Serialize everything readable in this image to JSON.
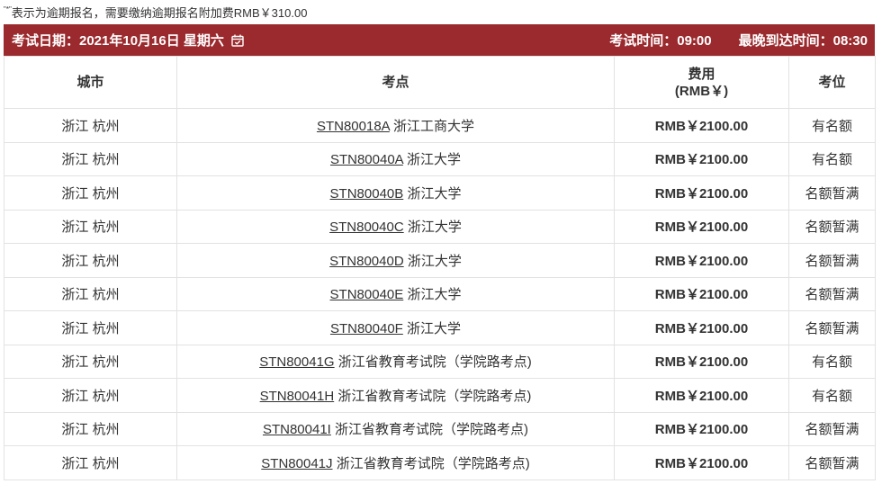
{
  "note": {
    "mark": "\"*\"",
    "text": "表示为逾期报名，需要缴纳逾期报名附加费RMB￥310.00"
  },
  "header": {
    "exam_date": "考试日期：2021年10月16日 星期六",
    "exam_time": "考试时间：09:00",
    "latest_arrival": "最晚到达时间：08:30",
    "calendar_icon": "calendar-check-icon"
  },
  "table": {
    "columns": [
      "城市",
      "考点",
      "费用",
      "(RMB￥)",
      "考位"
    ],
    "rows": [
      {
        "city": "浙江 杭州",
        "code": "STN80018A",
        "center": "浙江工商大学",
        "fee": "RMB￥2100.00",
        "seat": "有名额"
      },
      {
        "city": "浙江 杭州",
        "code": "STN80040A",
        "center": "浙江大学",
        "fee": "RMB￥2100.00",
        "seat": "有名额"
      },
      {
        "city": "浙江 杭州",
        "code": "STN80040B",
        "center": "浙江大学",
        "fee": "RMB￥2100.00",
        "seat": "名额暂满"
      },
      {
        "city": "浙江 杭州",
        "code": "STN80040C",
        "center": "浙江大学",
        "fee": "RMB￥2100.00",
        "seat": "名额暂满"
      },
      {
        "city": "浙江 杭州",
        "code": "STN80040D",
        "center": "浙江大学",
        "fee": "RMB￥2100.00",
        "seat": "名额暂满"
      },
      {
        "city": "浙江 杭州",
        "code": "STN80040E",
        "center": "浙江大学",
        "fee": "RMB￥2100.00",
        "seat": "名额暂满"
      },
      {
        "city": "浙江 杭州",
        "code": "STN80040F",
        "center": "浙江大学",
        "fee": "RMB￥2100.00",
        "seat": "名额暂满"
      },
      {
        "city": "浙江 杭州",
        "code": "STN80041G",
        "center": "浙江省教育考试院（学院路考点)",
        "fee": "RMB￥2100.00",
        "seat": "有名额"
      },
      {
        "city": "浙江 杭州",
        "code": "STN80041H",
        "center": "浙江省教育考试院（学院路考点)",
        "fee": "RMB￥2100.00",
        "seat": "有名额"
      },
      {
        "city": "浙江 杭州",
        "code": "STN80041I",
        "center": "浙江省教育考试院（学院路考点)",
        "fee": "RMB￥2100.00",
        "seat": "名额暂满"
      },
      {
        "city": "浙江 杭州",
        "code": "STN80041J",
        "center": "浙江省教育考试院（学院路考点)",
        "fee": "RMB￥2100.00",
        "seat": "名额暂满"
      }
    ]
  },
  "colors": {
    "header_bg": "#9b2a2e",
    "header_text": "#ffffff",
    "border": "#e2e2e2",
    "text": "#333333"
  }
}
